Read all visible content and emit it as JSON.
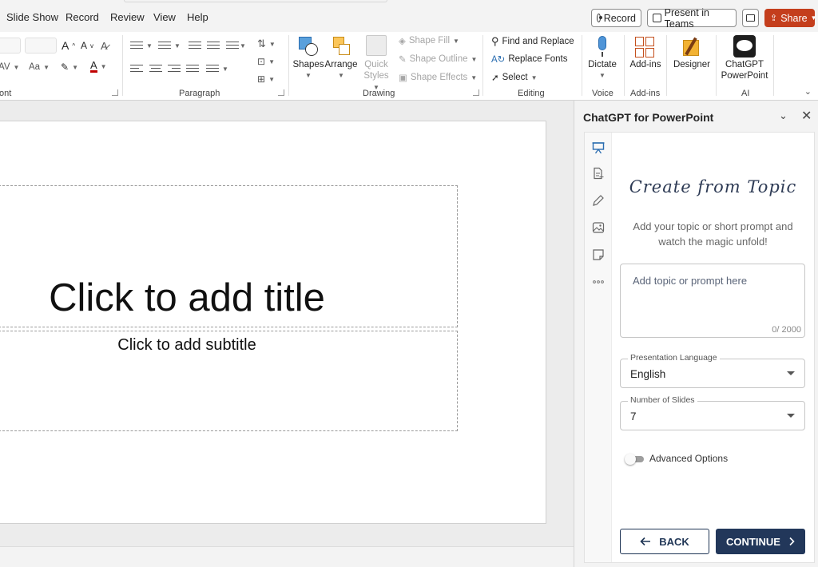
{
  "menu": {
    "items": [
      "Slide Show",
      "Record",
      "Review",
      "View",
      "Help"
    ],
    "record_button": "Record",
    "present_button": "Present in Teams",
    "share_button": "Share"
  },
  "ribbon": {
    "font_group": "ont",
    "paragraph_group": "Paragraph",
    "drawing_group": "Drawing",
    "editing_group": "Editing",
    "voice_group": "Voice",
    "addins_group": "Add-ins",
    "ai_group": "AI",
    "shapes": "Shapes",
    "arrange": "Arrange",
    "quick_styles_1": "Quick",
    "quick_styles_2": "Styles",
    "shape_fill": "Shape Fill",
    "shape_outline": "Shape Outline",
    "shape_effects": "Shape Effects",
    "find_replace": "Find and Replace",
    "replace_fonts": "Replace Fonts",
    "select": "Select",
    "dictate": "Dictate",
    "add_ins": "Add-ins",
    "designer": "Designer",
    "chatgpt_1": "ChatGPT",
    "chatgpt_2": "PowerPoint",
    "font_size_grow": "A",
    "font_size_shrink": "A",
    "char_spacing": "AV",
    "change_case": "Aa"
  },
  "slide": {
    "title_placeholder": "Click to add title",
    "subtitle_placeholder": "Click to add subtitle"
  },
  "pane": {
    "title": "ChatGPT for PowerPoint",
    "heading": "Create from Topic",
    "subheading": "Add your topic or short prompt and watch the magic unfold!",
    "topic_placeholder": "Add topic or prompt here",
    "char_count": "0/ 2000",
    "language_label": "Presentation Language",
    "language_value": "English",
    "slides_label": "Number of Slides",
    "slides_value": "7",
    "advanced_label": "Advanced Options",
    "back_label": "BACK",
    "continue_label": "CONTINUE"
  },
  "colors": {
    "accent": "#22375a",
    "share": "#c43e1c"
  }
}
